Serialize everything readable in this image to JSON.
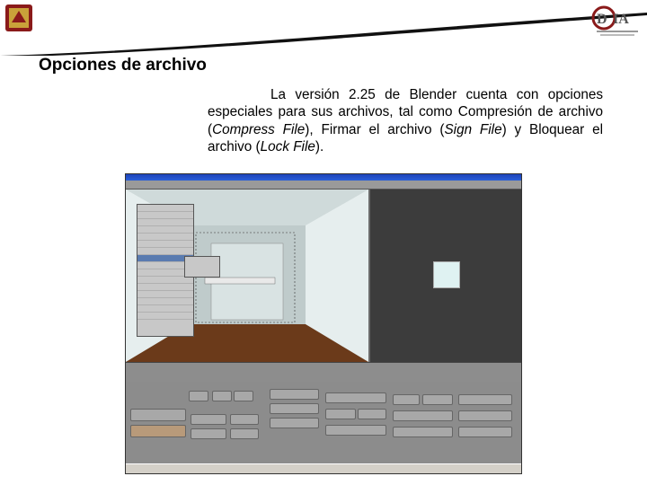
{
  "header": {
    "crest_icon": "university-crest-icon",
    "logo_icon": "dia-logo-icon",
    "swoosh_color": "#1a1a1a"
  },
  "slide": {
    "title": "Opciones de archivo",
    "paragraph": {
      "p1": "La versión 2.25 de Blender cuenta con opciones especiales para sus archivos, tal como Compresión de archivo (",
      "i1": "Compress File",
      "p2": "), Firmar el archivo (",
      "i2": "Sign File",
      "p3": ") y Bloquear el archivo (",
      "i3": "Lock File",
      "p4": ")."
    }
  },
  "screenshot": {
    "app_icon": "blender-screenshot-image",
    "viewport_color": "#c9d3d3",
    "floor_color": "#6b3a1a",
    "dark_view_color": "#3c3c3c"
  }
}
